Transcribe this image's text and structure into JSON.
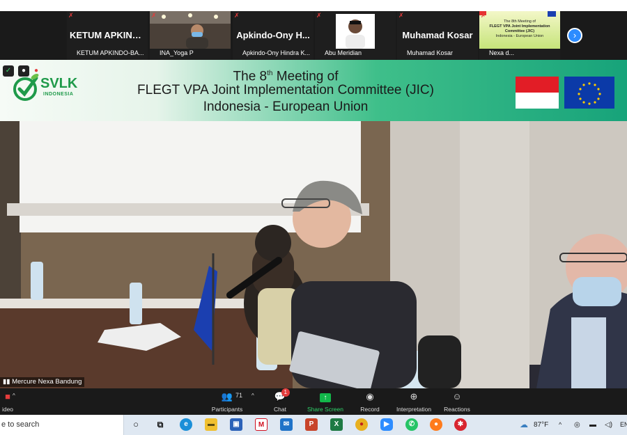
{
  "participants": [
    {
      "display": "KETUM  APKIND...",
      "caption": "KETUM APKINDO-BA...",
      "type": "text"
    },
    {
      "display": "",
      "caption": "INA_Yoga P",
      "type": "photo"
    },
    {
      "display": "Apkindo-Ony H...",
      "caption": "Apkindo-Ony Hindra K...",
      "type": "text"
    },
    {
      "display": "",
      "caption": "Abu Meridian",
      "type": "photo"
    },
    {
      "display": "Muhamad Kosar",
      "caption": "Muhamad Kosar",
      "type": "text"
    },
    {
      "display": "",
      "caption": "Nexa d...",
      "type": "slide"
    }
  ],
  "next_page_icon": "chevron-right-icon",
  "banner": {
    "line1_pre": "The 8",
    "line1_sup": "th",
    "line1_post": " Meeting of",
    "line2": "FLEGT VPA Joint Implementation Committee (JIC)",
    "line3": "Indonesia - European Union",
    "logo_text": "SVLK",
    "logo_sub": "INDONESIA"
  },
  "mini_slide": {
    "line1": "The 8th Meeting of",
    "line2": "FLEGT VPA Joint Implementation Committee (JIC)",
    "line3": "Indonesia - European Union"
  },
  "room_label": "Mercure Nexa Bandung",
  "controls": {
    "video_label": "ideo",
    "participants_label": "Participants",
    "participants_count": "71",
    "chat_label": "Chat",
    "chat_badge": "1",
    "share_label": "Share Screen",
    "record_label": "Record",
    "interpretation_label": "Interpretation",
    "reactions_label": "Reactions"
  },
  "taskbar": {
    "search_placeholder": "e to search",
    "temperature": "87°F",
    "lang": "EN",
    "apps": [
      "cortana-icon",
      "task-view-icon",
      "edge-icon",
      "file-explorer-icon",
      "store-icon",
      "mcafee-icon",
      "mail-icon",
      "powerpoint-icon",
      "excel-icon",
      "chrome-icon",
      "zoom-icon",
      "whatsapp-icon",
      "firefox-icon",
      "puzzle-app-icon"
    ]
  },
  "colors": {
    "zoom_bar": "#1a1a1a",
    "share_green": "#12b84a",
    "badge_red": "#e43c3c",
    "banner_green": "#17a37a",
    "zoom_blue": "#2d8cff"
  }
}
